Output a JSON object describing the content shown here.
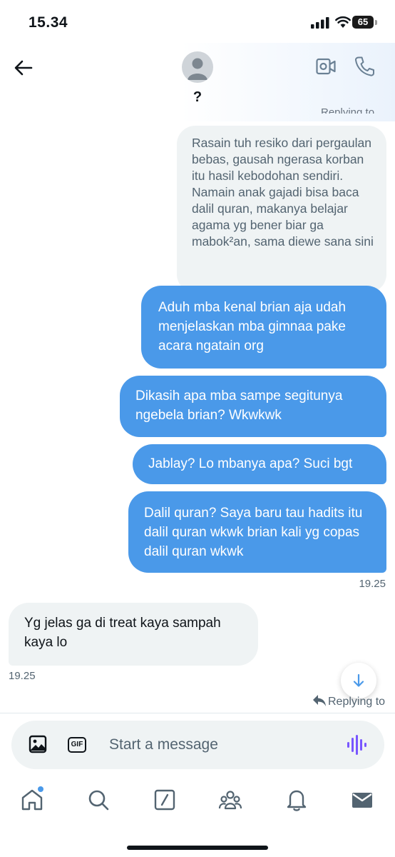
{
  "status_bar": {
    "time": "15.34",
    "battery": "65"
  },
  "header": {
    "contact_name": "?",
    "cut_text": "Replying to"
  },
  "messages": {
    "quoted_text": "Rasain tuh resiko dari pergaulan bebas, gausah ngerasa korban itu hasil kebodohan sendiri. Namain anak gajadi bisa baca dalil quran, makanya belajar agama yg bener biar ga mabok²an, sama diewe sana sini",
    "out1": "Aduh mba kenal brian aja udah menjelaskan mba gimnaa pake acara ngatain org",
    "out2": "Dikasih apa mba sampe segitunya ngebela brian? Wkwkwk",
    "out3": "Jablay? Lo mbanya apa? Suci bgt",
    "out4": "Dalil quran? Saya baru tau hadits itu dalil quran wkwk brian kali yg copas dalil quran wkwk",
    "out_time": "19.25",
    "in1": "Yg jelas ga di treat kaya sampah kaya lo",
    "in_time": "19.25"
  },
  "replying_label": "Replying to",
  "composer": {
    "placeholder": "Start a message",
    "gif_label": "GIF"
  },
  "icons": {
    "back": "arrow-left-icon",
    "video": "video-icon",
    "phone": "phone-icon",
    "image": "image-icon",
    "gif": "gif-icon",
    "voice": "voice-waveform-icon",
    "tabs": [
      "home-icon",
      "search-icon",
      "grok-icon",
      "communities-icon",
      "notifications-icon",
      "messages-icon"
    ]
  },
  "colors": {
    "accent": "#4a99e9",
    "incoming_bubble": "#eff3f4",
    "voice": "#7856ff"
  }
}
